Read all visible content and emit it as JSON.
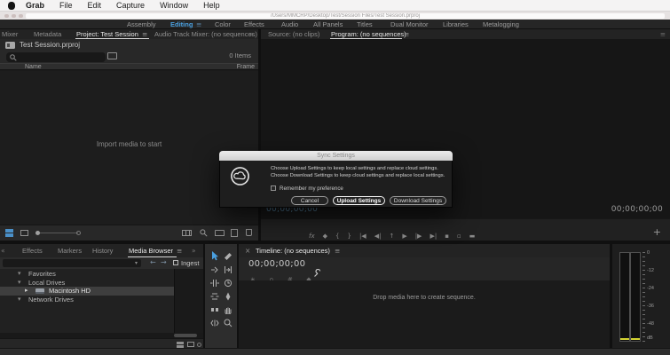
{
  "menubar": {
    "items": [
      "Grab",
      "File",
      "Edit",
      "Capture",
      "Window",
      "Help"
    ]
  },
  "titlebar": {
    "path": "/Users/MMCRP/Desktop/Test/Session Files/Test Session.prproj"
  },
  "workspace": {
    "tabs": [
      "Assembly",
      "Editing",
      "Color",
      "Effects",
      "Audio",
      "All Panels",
      "Titles",
      "Dual Monitor",
      "Libraries",
      "Metalogging"
    ],
    "active": "Editing"
  },
  "project": {
    "tabs": [
      "Mixer",
      "Metadata",
      "Project: Test Session",
      "Audio Track Mixer: (no sequences)"
    ],
    "active_tab": "Project: Test Session",
    "filename": "Test Session.prproj",
    "items_count": "0 Items",
    "columns": {
      "name": "Name",
      "frame": "Frame"
    },
    "empty_text": "Import media to start"
  },
  "monitor": {
    "tabs": [
      "Source: (no clips)",
      "Program: (no sequences)"
    ],
    "active_tab": "Program: (no sequences)",
    "timecode_left": "00;00;00;00",
    "timecode_right": "00;00;00;00",
    "transport": [
      "fx",
      "◆",
      "{",
      "}",
      "|◀",
      "◀|",
      "↑",
      "▶",
      "|▶",
      "▶|",
      "▪",
      "▫",
      "▬"
    ],
    "plus": "+"
  },
  "dialog": {
    "title": "Sync Settings",
    "line1": "Choose Upload Settings to keep local settings and replace cloud settings.",
    "line2": "Choose Download Settings to keep cloud settings and replace local settings.",
    "checkbox_label": "Remember my preference",
    "buttons": {
      "cancel": "Cancel",
      "upload": "Upload Settings",
      "download": "Download Settings"
    }
  },
  "bottom_tabs": {
    "items": [
      "Effects",
      "Markers",
      "History",
      "Media Browser"
    ],
    "active": "Media Browser"
  },
  "media_browser": {
    "ingest_label": "Ingest",
    "tree": [
      {
        "label": "Favorites"
      },
      {
        "label": "Local Drives"
      },
      {
        "label": "Macintosh HD"
      },
      {
        "label": "Network Drives"
      }
    ],
    "selected": "Macintosh HD"
  },
  "timeline": {
    "tab": "Timeline: (no sequences)",
    "timecode": "00;00;00;00",
    "empty_text": "Drop media here to create sequence."
  },
  "audio_meter": {
    "labels": [
      "0",
      "-12",
      "-24",
      "-36",
      "-48",
      "dB"
    ]
  },
  "icons": {
    "hamburger": "≡",
    "chevron_double": "»",
    "chevron_double_left": "«",
    "chevron_down": "▾",
    "chevron_right": "▸",
    "back_arrow": "←",
    "forward_arrow": "→",
    "close": "×",
    "marker": "◆",
    "snap": "∩",
    "asterisk": "∗",
    "hash": "#"
  },
  "colors": {
    "accent_blue": "#4AA0E0",
    "timecode_blue": "#54809F",
    "meter_yellow": "#D3D332",
    "dialog_titlebar": "#DCDCDC"
  }
}
